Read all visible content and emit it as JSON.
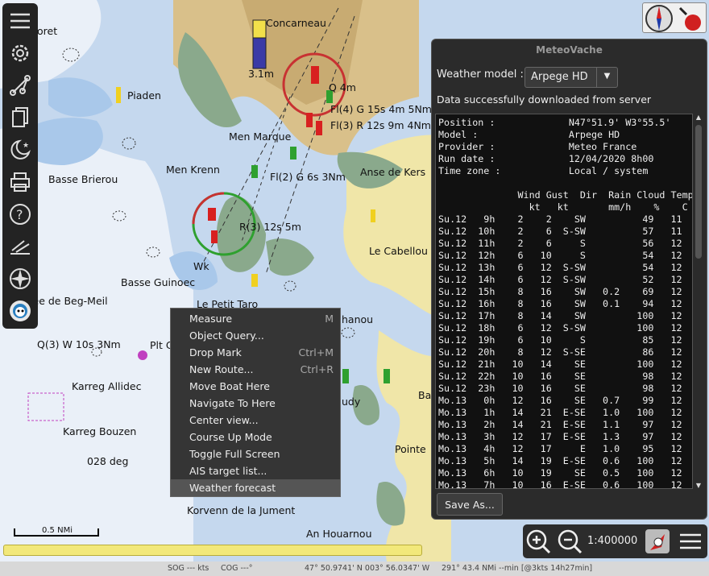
{
  "chart": {
    "place_names": [
      {
        "text": "Concarneau"
      },
      {
        "text": "Piaden"
      },
      {
        "text": "Men Marque"
      },
      {
        "text": "Men Krenn"
      },
      {
        "text": "Basse Brierou"
      },
      {
        "text": "Anse de Kers"
      },
      {
        "text": "Le Cabellou"
      },
      {
        "text": "Basse Guinoec"
      },
      {
        "text": "see de Beg-Meil"
      },
      {
        "text": "Le Petit Taro"
      },
      {
        "text": "Karreg Allidec"
      },
      {
        "text": "Karreg Bouzen"
      },
      {
        "text": "Korvenn de la Jument"
      },
      {
        "text": "An Houarnou"
      },
      {
        "text": "Pointe"
      },
      {
        "text": "oret"
      },
      {
        "text": "hanou"
      },
      {
        "text": "udy"
      },
      {
        "text": "Ba"
      }
    ],
    "light_labels": [
      {
        "text": "Fl(4) G 15s 4m 5Nm"
      },
      {
        "text": "Fl(3) R 12s 9m 4Nm"
      },
      {
        "text": "Fl(2) G 6s 3Nm"
      },
      {
        "text": "R(3) 12s 5m"
      },
      {
        "text": "Q(3) W 10s 3Nm"
      },
      {
        "text": "Q 4m"
      },
      {
        "text": "Plt C"
      },
      {
        "text": "Wk"
      }
    ],
    "tide_height": "3.1m",
    "heading_label": "028 deg",
    "scale_bar_label": "0.5 NMi"
  },
  "toolbar": {
    "icons": [
      "menu-icon",
      "settings-icon",
      "route-icon",
      "copy-icon",
      "moon-star-icon",
      "print-icon",
      "help-icon",
      "tracks-icon",
      "compass-icon",
      "plugin-icon"
    ]
  },
  "meteo": {
    "title": "MeteoVache",
    "model_label": "Weather model :",
    "model_value": "Arpege HD",
    "status": "Data successfully downloaded from server",
    "info_lines": [
      "Position :             N47°51.9' W3°55.5'",
      "Model :                Arpege HD",
      "Provider :             Meteo France",
      "Run date :             12/04/2020 8h00",
      "Time zone :            Local / system"
    ],
    "table_header": [
      "              Wind Gust  Dir  Rain Cloud Temp",
      "                kt   kt       mm/h    %    C"
    ],
    "rows": [
      [
        "Su.12",
        "9h",
        "2",
        "2",
        "SW",
        "",
        "49",
        "11"
      ],
      [
        "Su.12",
        "10h",
        "2",
        "6",
        "S-SW",
        "",
        "57",
        "11"
      ],
      [
        "Su.12",
        "11h",
        "2",
        "6",
        "S",
        "",
        "56",
        "12"
      ],
      [
        "Su.12",
        "12h",
        "6",
        "10",
        "S",
        "",
        "54",
        "12"
      ],
      [
        "Su.12",
        "13h",
        "6",
        "12",
        "S-SW",
        "",
        "54",
        "12"
      ],
      [
        "Su.12",
        "14h",
        "6",
        "12",
        "S-SW",
        "",
        "52",
        "12"
      ],
      [
        "Su.12",
        "15h",
        "8",
        "16",
        "SW",
        "0.2",
        "69",
        "12"
      ],
      [
        "Su.12",
        "16h",
        "8",
        "16",
        "SW",
        "0.1",
        "94",
        "12"
      ],
      [
        "Su.12",
        "17h",
        "8",
        "14",
        "SW",
        "",
        "100",
        "12"
      ],
      [
        "Su.12",
        "18h",
        "6",
        "12",
        "S-SW",
        "",
        "100",
        "12"
      ],
      [
        "Su.12",
        "19h",
        "6",
        "10",
        "S",
        "",
        "85",
        "12"
      ],
      [
        "Su.12",
        "20h",
        "8",
        "12",
        "S-SE",
        "",
        "86",
        "12"
      ],
      [
        "Su.12",
        "21h",
        "10",
        "14",
        "SE",
        "",
        "100",
        "12"
      ],
      [
        "Su.12",
        "22h",
        "10",
        "16",
        "SE",
        "",
        "98",
        "12"
      ],
      [
        "Su.12",
        "23h",
        "10",
        "16",
        "SE",
        "",
        "98",
        "12"
      ],
      [
        "Mo.13",
        "0h",
        "12",
        "16",
        "SE",
        "0.7",
        "99",
        "12"
      ],
      [
        "Mo.13",
        "1h",
        "14",
        "21",
        "E-SE",
        "1.0",
        "100",
        "12"
      ],
      [
        "Mo.13",
        "2h",
        "14",
        "21",
        "E-SE",
        "1.1",
        "97",
        "12"
      ],
      [
        "Mo.13",
        "3h",
        "12",
        "17",
        "E-SE",
        "1.3",
        "97",
        "12"
      ],
      [
        "Mo.13",
        "4h",
        "12",
        "17",
        "E",
        "1.0",
        "95",
        "12"
      ],
      [
        "Mo.13",
        "5h",
        "14",
        "19",
        "E-SE",
        "0.6",
        "100",
        "12"
      ],
      [
        "Mo.13",
        "6h",
        "10",
        "19",
        "SE",
        "0.5",
        "100",
        "12"
      ],
      [
        "Mo.13",
        "7h",
        "10",
        "16",
        "E-SE",
        "0.6",
        "100",
        "12"
      ]
    ],
    "save_label": "Save As..."
  },
  "context_menu": {
    "items": [
      {
        "label": "Measure",
        "shortcut": "M"
      },
      {
        "label": "Object Query...",
        "shortcut": ""
      },
      {
        "label": "Drop Mark",
        "shortcut": "Ctrl+M"
      },
      {
        "label": "New Route...",
        "shortcut": "Ctrl+R"
      },
      {
        "label": "Move Boat Here",
        "shortcut": ""
      },
      {
        "label": "Navigate To Here",
        "shortcut": ""
      },
      {
        "label": "Center view...",
        "shortcut": ""
      },
      {
        "label": "Course Up Mode",
        "shortcut": ""
      },
      {
        "label": "Toggle Full Screen",
        "shortcut": ""
      },
      {
        "label": "AIS target list...",
        "shortcut": ""
      },
      {
        "label": "Weather forecast",
        "shortcut": ""
      }
    ],
    "highlighted": "Weather forecast"
  },
  "zoom": {
    "scale": "1:400000"
  },
  "statusbar": {
    "sog": "SOG --- kts",
    "cog": "COG ---°",
    "position": "47° 50.9741' N   003° 56.0347' W",
    "bearing": "291°  43.4 NMi --min [@3kts 14h27min]"
  },
  "colors": {
    "land": "#d9c08a",
    "shallow": "#a9c8ea",
    "deep": "#e8eef5",
    "drying": "#8aa98c"
  }
}
